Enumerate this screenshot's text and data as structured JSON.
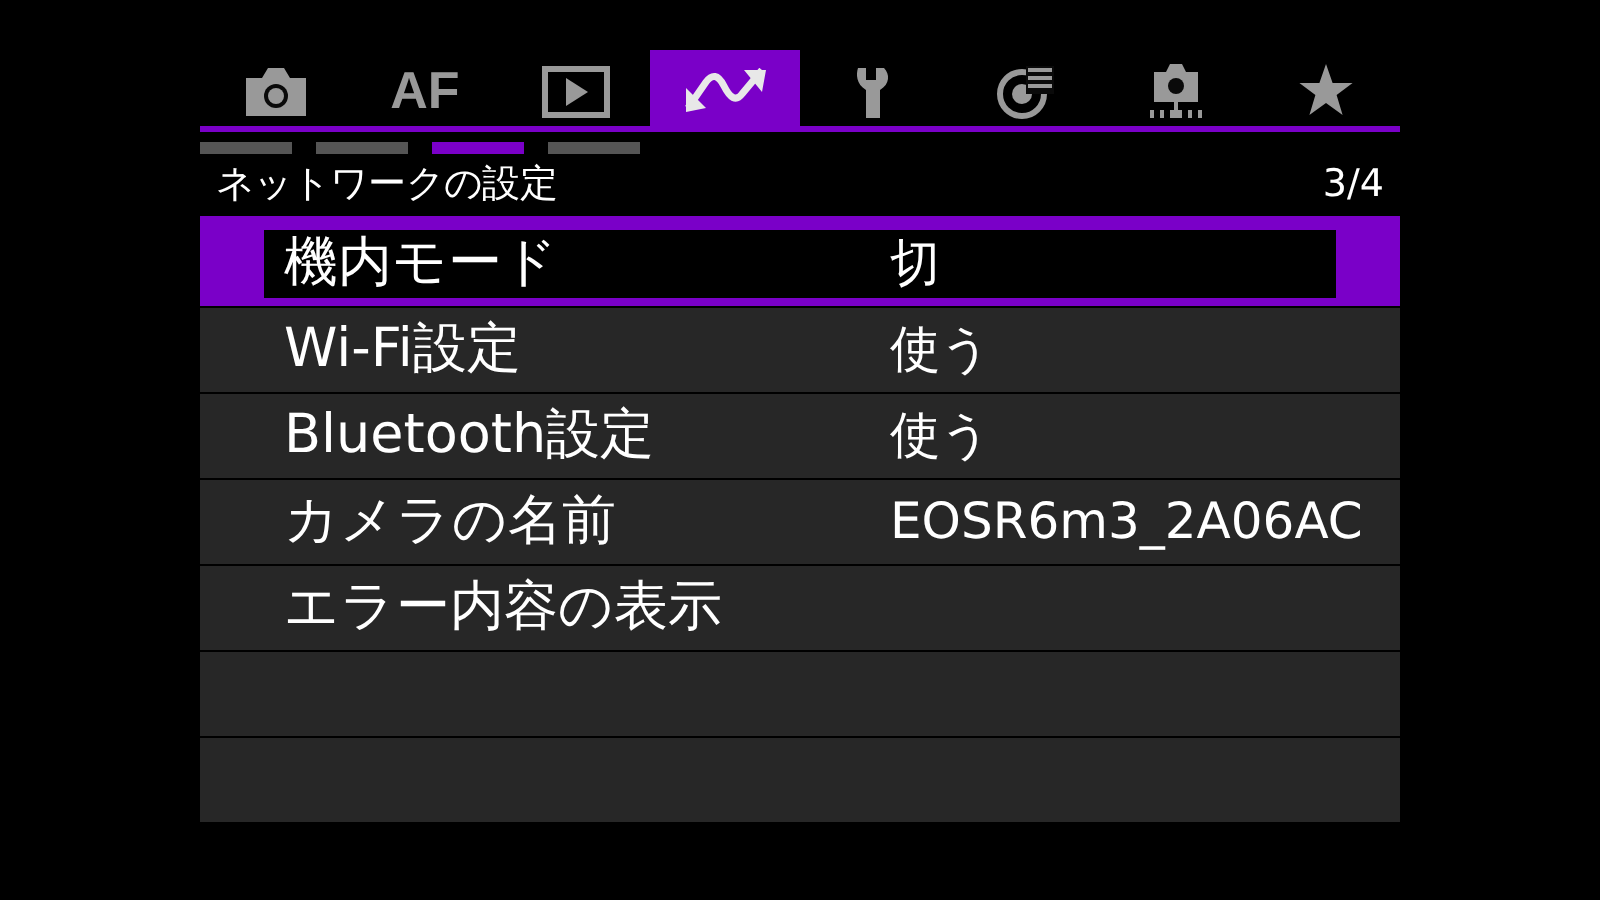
{
  "tabs": [
    {
      "kind": "camera",
      "selected": false
    },
    {
      "kind": "text",
      "label": "AF",
      "selected": false
    },
    {
      "kind": "play",
      "selected": false
    },
    {
      "kind": "network",
      "selected": true
    },
    {
      "kind": "wrench",
      "selected": false
    },
    {
      "kind": "custom",
      "selected": false
    },
    {
      "kind": "camera-dots",
      "selected": false
    },
    {
      "kind": "star",
      "selected": false
    }
  ],
  "pages": [
    {
      "selected": false
    },
    {
      "selected": false
    },
    {
      "selected": true
    },
    {
      "selected": false
    }
  ],
  "menu": {
    "title": "ネットワークの設定",
    "page": "3/4",
    "items": [
      {
        "label": "機内モード",
        "value": "切",
        "selected": true
      },
      {
        "label": "Wi-Fi設定",
        "value": "使う",
        "selected": false
      },
      {
        "label": "Bluetooth設定",
        "value": "使う",
        "selected": false
      },
      {
        "label": "カメラの名前",
        "value": "EOSR6m3_2A06AC",
        "selected": false
      },
      {
        "label": "エラー内容の表示",
        "selected": false
      }
    ]
  }
}
